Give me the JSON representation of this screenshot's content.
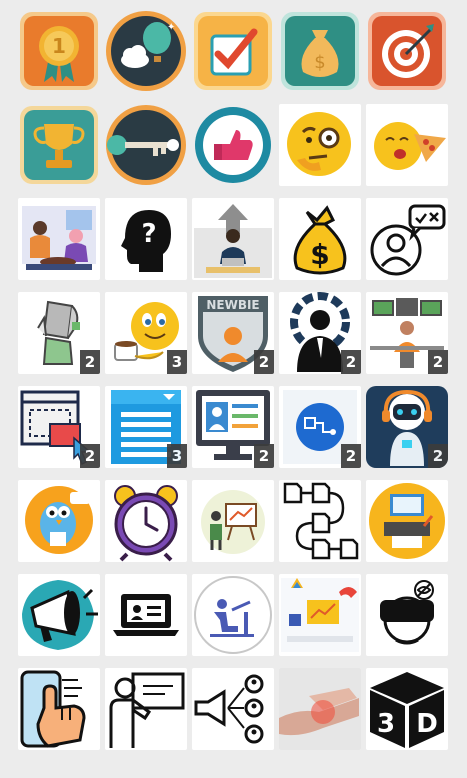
{
  "grid": {
    "columns": 5,
    "rows": 8,
    "tiles": [
      {
        "name": "medal-badge-icon",
        "bg": "#f29a3c"
      },
      {
        "name": "hot-air-balloon-icon",
        "bg": "#e9902e"
      },
      {
        "name": "checkbox-icon",
        "bg": "#f6b346"
      },
      {
        "name": "money-bag-icon",
        "bg": "#2f8f84"
      },
      {
        "name": "target-icon",
        "bg": "#d9542d"
      },
      {
        "name": "trophy-icon",
        "bg": "#3a9d97"
      },
      {
        "name": "key-icon",
        "bg": "#2a3b44"
      },
      {
        "name": "thumbs-up-icon",
        "bg": "#1e8aa2"
      },
      {
        "name": "thinking-emoji-icon",
        "bg": "#ffffff"
      },
      {
        "name": "pizza-emoji-icon",
        "bg": "#ffffff"
      },
      {
        "name": "people-chatting-illustration",
        "bg": "#ffffff"
      },
      {
        "name": "head-question-mark-icon",
        "bg": "#ffffff"
      },
      {
        "name": "person-laptop-illustration",
        "bg": "#ffffff"
      },
      {
        "name": "dollar-sack-icon",
        "bg": "#ffffff"
      },
      {
        "name": "user-check-bubble-icon",
        "bg": "#ffffff"
      },
      {
        "name": "person-reading-book-illustration",
        "bg": "#ffffff",
        "badge": "2"
      },
      {
        "name": "coffee-emoji-icon",
        "bg": "#ffffff",
        "badge": "3"
      },
      {
        "name": "newbie-badge-icon",
        "bg": "#ffffff",
        "badge": "2"
      },
      {
        "name": "manager-gear-icon",
        "bg": "#ffffff",
        "badge": "2"
      },
      {
        "name": "developer-desk-illustration",
        "bg": "#ffffff",
        "badge": "2"
      },
      {
        "name": "screen-cursor-icon",
        "bg": "#ffffff",
        "badge": "2"
      },
      {
        "name": "document-list-icon",
        "bg": "#ffffff",
        "badge": "3"
      },
      {
        "name": "computer-profile-icon",
        "bg": "#ffffff",
        "badge": "2"
      },
      {
        "name": "flowchart-screen-icon",
        "bg": "#ffffff",
        "badge": "2"
      },
      {
        "name": "robot-headset-icon",
        "bg": "#1f3d5c",
        "badge": "2"
      },
      {
        "name": "bird-mascot-icon",
        "bg": "#ffffff"
      },
      {
        "name": "alarm-clock-icon",
        "bg": "#ffffff"
      },
      {
        "name": "presenter-board-icon",
        "bg": "#ffffff"
      },
      {
        "name": "document-flow-icon",
        "bg": "#ffffff"
      },
      {
        "name": "printer-computer-icon",
        "bg": "#ffffff"
      },
      {
        "name": "megaphone-icon",
        "bg": "#ffffff"
      },
      {
        "name": "id-laptop-icon",
        "bg": "#ffffff"
      },
      {
        "name": "person-workstation-icon",
        "bg": "#ffffff"
      },
      {
        "name": "analytics-dashboard-icon",
        "bg": "#ffffff"
      },
      {
        "name": "vr-headset-icon",
        "bg": "#ffffff"
      },
      {
        "name": "phone-tap-icon",
        "bg": "#ffffff"
      },
      {
        "name": "teacher-board-icon",
        "bg": "#ffffff"
      },
      {
        "name": "megaphone-network-icon",
        "bg": "#ffffff"
      },
      {
        "name": "wrist-pain-photo",
        "bg": "#ffffff"
      },
      {
        "name": "3d-cube-icon",
        "bg": "#ffffff"
      }
    ]
  },
  "cube_label": {
    "left": "3",
    "right": "D"
  },
  "newbie_label": "NEWBIE"
}
